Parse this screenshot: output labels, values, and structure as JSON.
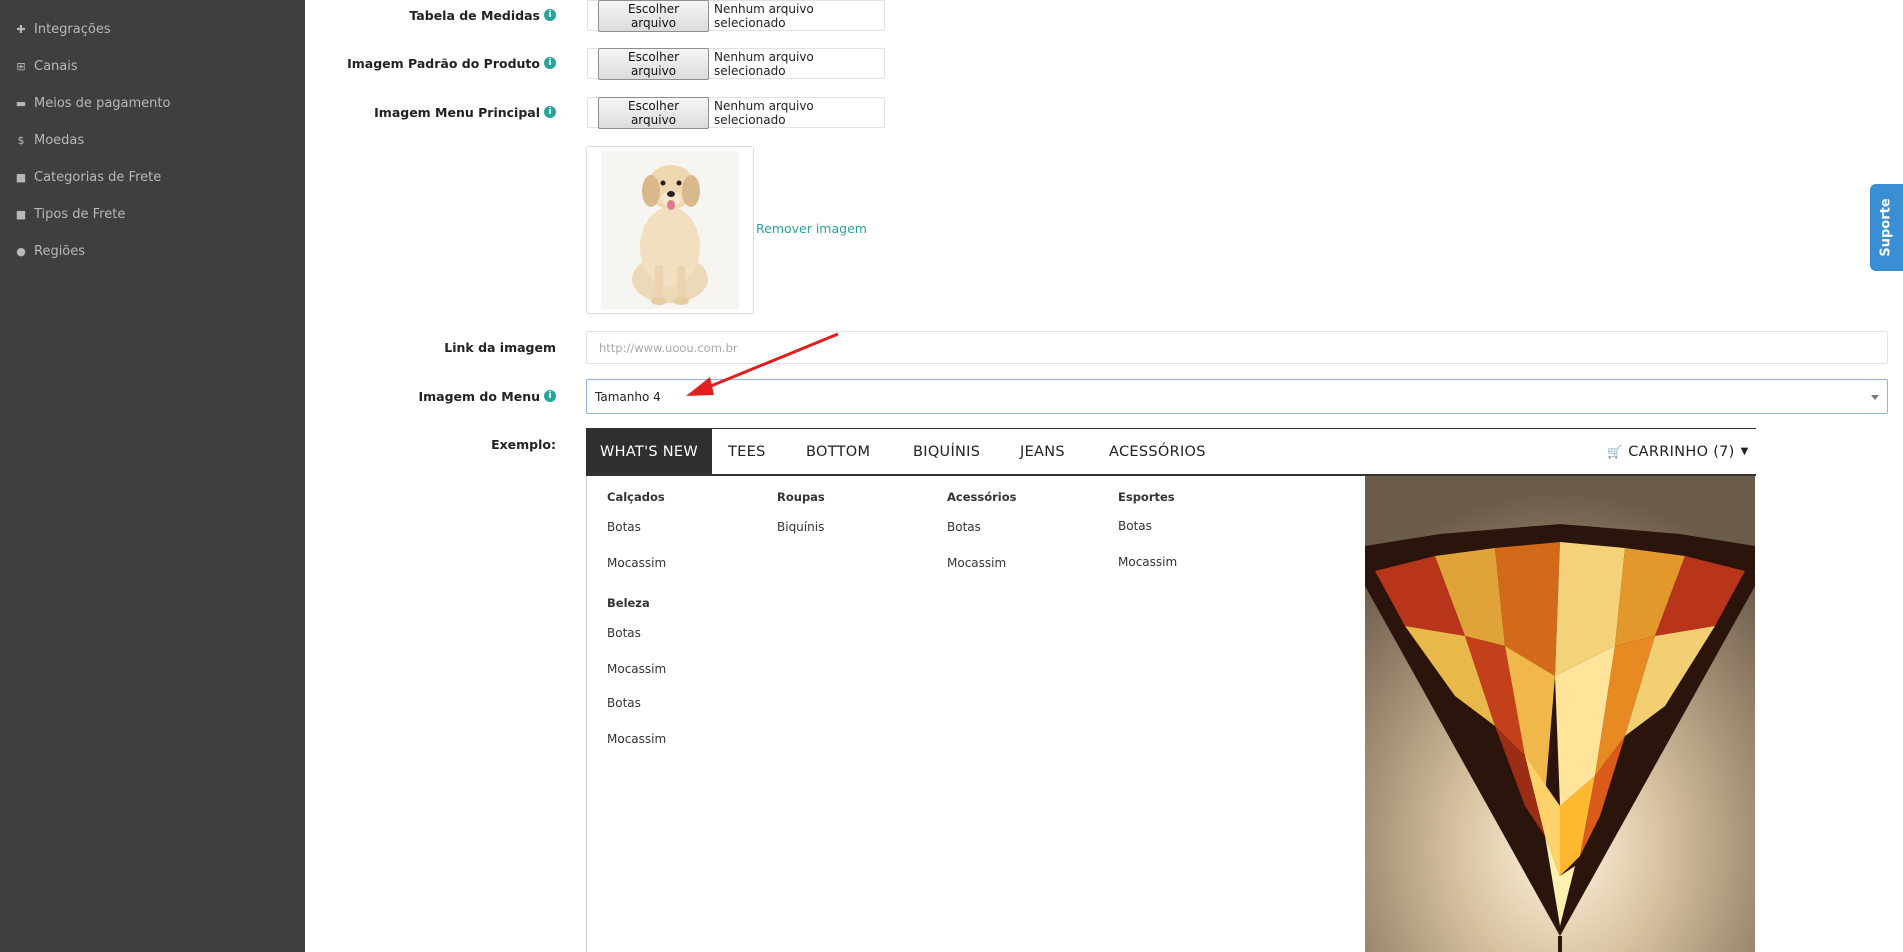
{
  "sidebar": {
    "items": [
      {
        "label": "Integrações",
        "icon": "puzzle-icon"
      },
      {
        "label": "Canais",
        "icon": "sitemap-icon"
      },
      {
        "label": "Meios de pagamento",
        "icon": "credit-card-icon"
      },
      {
        "label": "Moedas",
        "icon": "dollar-icon"
      },
      {
        "label": "Categorias de Frete",
        "icon": "truck-icon"
      },
      {
        "label": "Tipos de Frete",
        "icon": "truck-icon"
      },
      {
        "label": "Regiões",
        "icon": "globe-icon"
      }
    ]
  },
  "form": {
    "tabela_medidas": {
      "label": "Tabela de Medidas",
      "button": "Escolher arquivo",
      "status": "Nenhum arquivo selecionado"
    },
    "imagem_padrao": {
      "label": "Imagem Padrão do Produto",
      "button": "Escolher arquivo",
      "status": "Nenhum arquivo selecionado"
    },
    "imagem_menu_principal": {
      "label": "Imagem Menu Principal",
      "button": "Escolher arquivo",
      "status": "Nenhum arquivo selecionado"
    },
    "remover_imagem": "Remover imagem",
    "link_imagem": {
      "label": "Link da imagem",
      "placeholder": "http://www.uoou.com.br",
      "value": ""
    },
    "imagem_do_menu": {
      "label": "Imagem do Menu",
      "selected": "Tamanho 4"
    },
    "exemplo_label": "Exemplo:"
  },
  "example_menu": {
    "nav": [
      "WHAT'S NEW",
      "TEES",
      "BOTTOM",
      "BIQUÍNIS",
      "JEANS",
      "ACESSÓRIOS"
    ],
    "cart": "CARRINHO (7)",
    "columns": [
      {
        "heading": "Calçados",
        "links": [
          "Botas",
          "Mocassim"
        ]
      },
      {
        "heading": "Roupas",
        "links": [
          "Biquínis"
        ]
      },
      {
        "heading": "Acessórios",
        "links": [
          "Botas",
          "Mocassim"
        ]
      },
      {
        "heading": "Esportes",
        "links": [
          "Botas",
          "Mocassim"
        ]
      }
    ],
    "beleza": {
      "heading": "Beleza",
      "links": [
        "Botas",
        "Mocassim",
        "Botas",
        "Mocassim"
      ]
    }
  },
  "suporte": "Suporte",
  "colors": {
    "sidebar_bg": "#3f3f3f",
    "accent": "#27a59a",
    "active_nav": "#2f2f2f",
    "suporte": "#3a8ed4",
    "arrow": "#e02020"
  }
}
